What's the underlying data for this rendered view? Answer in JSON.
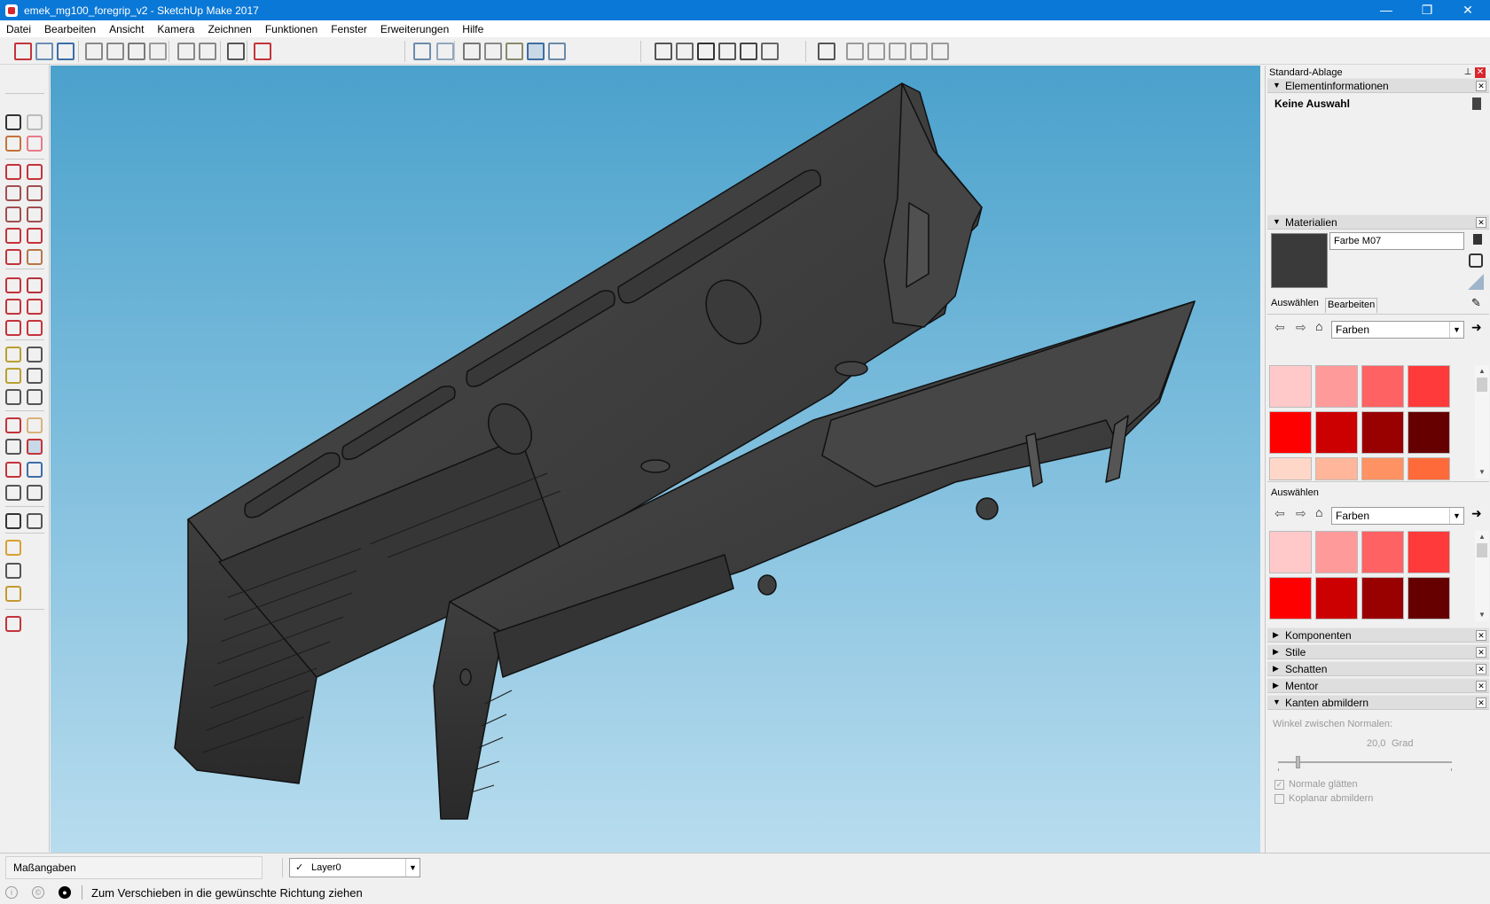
{
  "window": {
    "title": "emek_mg100_foregrip_v2 - SketchUp Make 2017",
    "minimize_glyph": "—",
    "maximize_glyph": "❐",
    "close_glyph": "✕"
  },
  "menu": [
    "Datei",
    "Bearbeiten",
    "Ansicht",
    "Kamera",
    "Zeichnen",
    "Funktionen",
    "Fenster",
    "Erweiterungen",
    "Hilfe"
  ],
  "toolbar": {
    "icons": [
      "new-model-icon",
      "open-icon",
      "save-icon",
      "cut-icon",
      "copy-icon",
      "paste-icon",
      "erase-icon",
      "undo-icon",
      "redo-icon",
      "print-icon",
      "model-info-icon",
      "xray-icon",
      "backedges-icon",
      "wireframe-icon",
      "hidden-line-icon",
      "shaded-icon",
      "shaded-textures-icon",
      "monochrome-icon",
      "iso-view-icon",
      "top-view-icon",
      "front-view-icon",
      "right-view-icon",
      "back-view-icon",
      "left-view-icon",
      "solid-tools-icon",
      "union-icon",
      "subtract-icon",
      "trim-icon",
      "intersect-icon",
      "split-icon"
    ]
  },
  "left_tools": [
    "select-icon",
    "make-component-icon",
    "paint-bucket-icon",
    "eraser-icon",
    "pencil-icon",
    "freehand-icon",
    "rectangle-icon",
    "rotated-rectangle-icon",
    "circle-icon",
    "polygon-icon",
    "arc-icon",
    "two-point-arc-icon",
    "three-point-arc-icon",
    "pie-icon",
    "move-icon",
    "push-pull-icon",
    "rotate-icon",
    "follow-me-icon",
    "scale-icon",
    "offset-icon",
    "tape-measure-icon",
    "dimension-icon",
    "protractor-icon",
    "text-icon",
    "axes-icon",
    "3d-text-icon",
    "orbit-icon",
    "pan-icon",
    "zoom-icon",
    "zoom-window-icon",
    "zoom-extents-icon",
    "previous-view-icon",
    "position-camera-icon",
    "look-around-icon",
    "walk-icon",
    "section-plane-icon",
    "warehouse-icon",
    "share-model-icon",
    "extension-warehouse-icon",
    "sketchup-logo-icon"
  ],
  "tray": {
    "title": "Standard-Ablage",
    "entity_info": {
      "header": "Elementinformationen",
      "selection": "Keine Auswahl"
    },
    "materials": {
      "header": "Materialien",
      "material_name": "Farbe M07",
      "tab_select": "Auswählen",
      "tab_edit": "Bearbeiten",
      "library": "Farben",
      "secondary_label": "Auswählen",
      "secondary_library": "Farben",
      "preview_color": "#3a3a3a",
      "swatches_top": [
        "#ffc9c9",
        "#ff9a9a",
        "#ff6262",
        "#ff3a3a",
        "#ff0000",
        "#cc0000",
        "#990000",
        "#660000",
        "#ffd7c9",
        "#ffb69a",
        "#ff9262",
        "#ff6a3a"
      ],
      "swatches_bottom": [
        "#ffc9c9",
        "#ff9a9a",
        "#ff6262",
        "#ff3a3a",
        "#ff0000",
        "#cc0000",
        "#990000",
        "#660000"
      ]
    },
    "collapsed_panels": [
      "Komponenten",
      "Stile",
      "Schatten",
      "Mentor"
    ],
    "soften": {
      "header": "Kanten abmildern",
      "angle_label": "Winkel zwischen Normalen:",
      "angle_value": "20,0",
      "angle_unit": "Grad",
      "slider_value_deg": 20,
      "smooth_normals": "Normale glätten",
      "smooth_normals_checked": true,
      "soften_coplanar": "Koplanar abmildern",
      "soften_coplanar_checked": false
    }
  },
  "status": {
    "measurements_label": "Maßangaben",
    "layer": "Layer0",
    "layer_check": "✓",
    "hint": "Zum Verschieben in die gewünschte Richtung ziehen"
  },
  "colors": {
    "titlebar": "#0a78d7",
    "sky_top": "#4aa1cc",
    "sky_bottom": "#b8dcee",
    "model_fill": "#3d3d3d"
  }
}
